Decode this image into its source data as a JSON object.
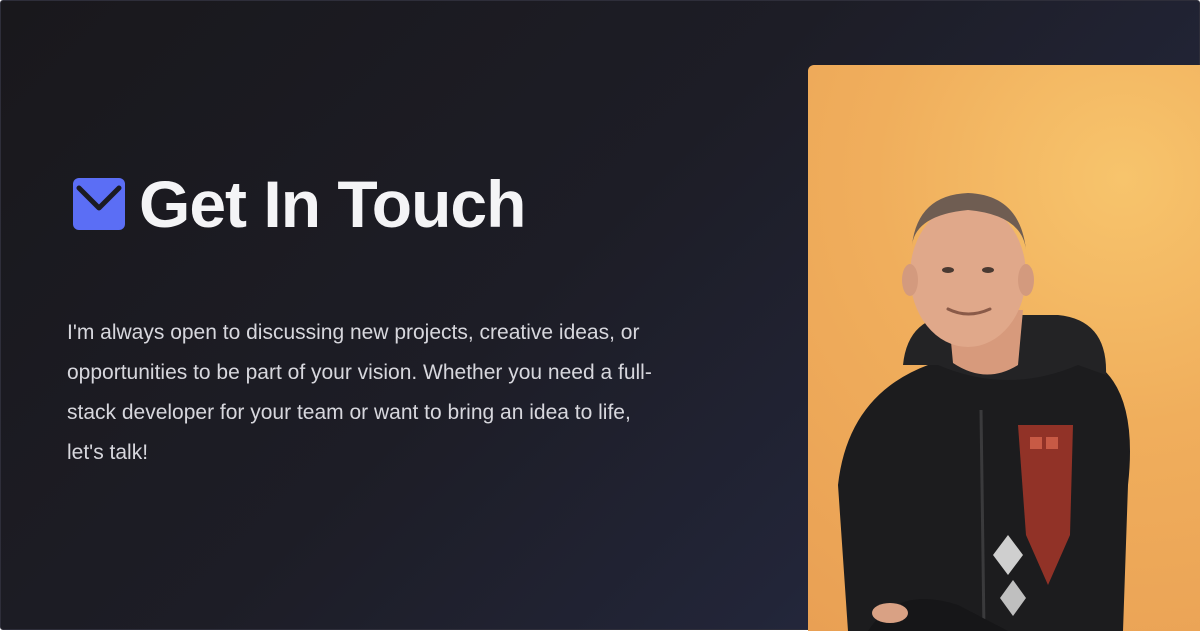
{
  "section": {
    "icon": "mail-icon",
    "title": "Get In Touch",
    "description": "I'm always open to discussing new projects, creative ideas, or opportunities to be part of your vision. Whether you need a full-stack developer for your team or want to bring an idea to life, let's talk!"
  },
  "colors": {
    "accent": "#5b6ef5",
    "photo_background": "#f0ae5c",
    "text": "#f4f4f6"
  }
}
